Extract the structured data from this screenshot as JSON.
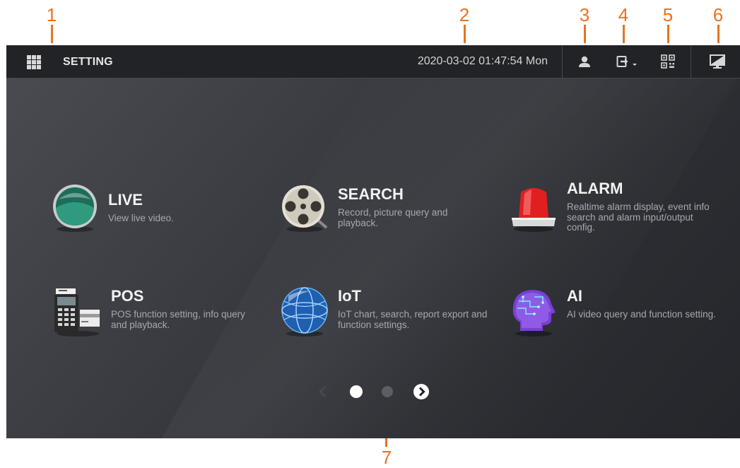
{
  "callouts": [
    "1",
    "2",
    "3",
    "4",
    "5",
    "6",
    "7"
  ],
  "topbar": {
    "title": "SETTING",
    "datetime": "2020-03-02 01:47:54 Mon",
    "icons": [
      "menu-grid-icon",
      "user-icon",
      "logout-icon",
      "qr-code-icon",
      "display-icon"
    ]
  },
  "tiles": [
    {
      "key": "live",
      "title": "LIVE",
      "desc": "View live video.",
      "icon": "live-globe-icon"
    },
    {
      "key": "search",
      "title": "SEARCH",
      "desc": "Record, picture query and playback.",
      "icon": "film-reel-icon"
    },
    {
      "key": "alarm",
      "title": "ALARM",
      "desc": "Realtime alarm display, event info search and alarm input/output config.",
      "icon": "alarm-light-icon"
    },
    {
      "key": "pos",
      "title": "POS",
      "desc": "POS function setting, info query and playback.",
      "icon": "pos-terminal-icon"
    },
    {
      "key": "iot",
      "title": "IoT",
      "desc": "IoT chart, search, report export and function settings.",
      "icon": "iot-globe-icon"
    },
    {
      "key": "ai",
      "title": "AI",
      "desc": "AI video query and function setting.",
      "icon": "ai-head-icon"
    }
  ],
  "pager": {
    "current_page": 1,
    "total_pages": 2
  },
  "colors": {
    "callout": "#e8731f",
    "topbar": "#222327",
    "background": "#3b3d43",
    "alarm_red": "#e02020"
  }
}
